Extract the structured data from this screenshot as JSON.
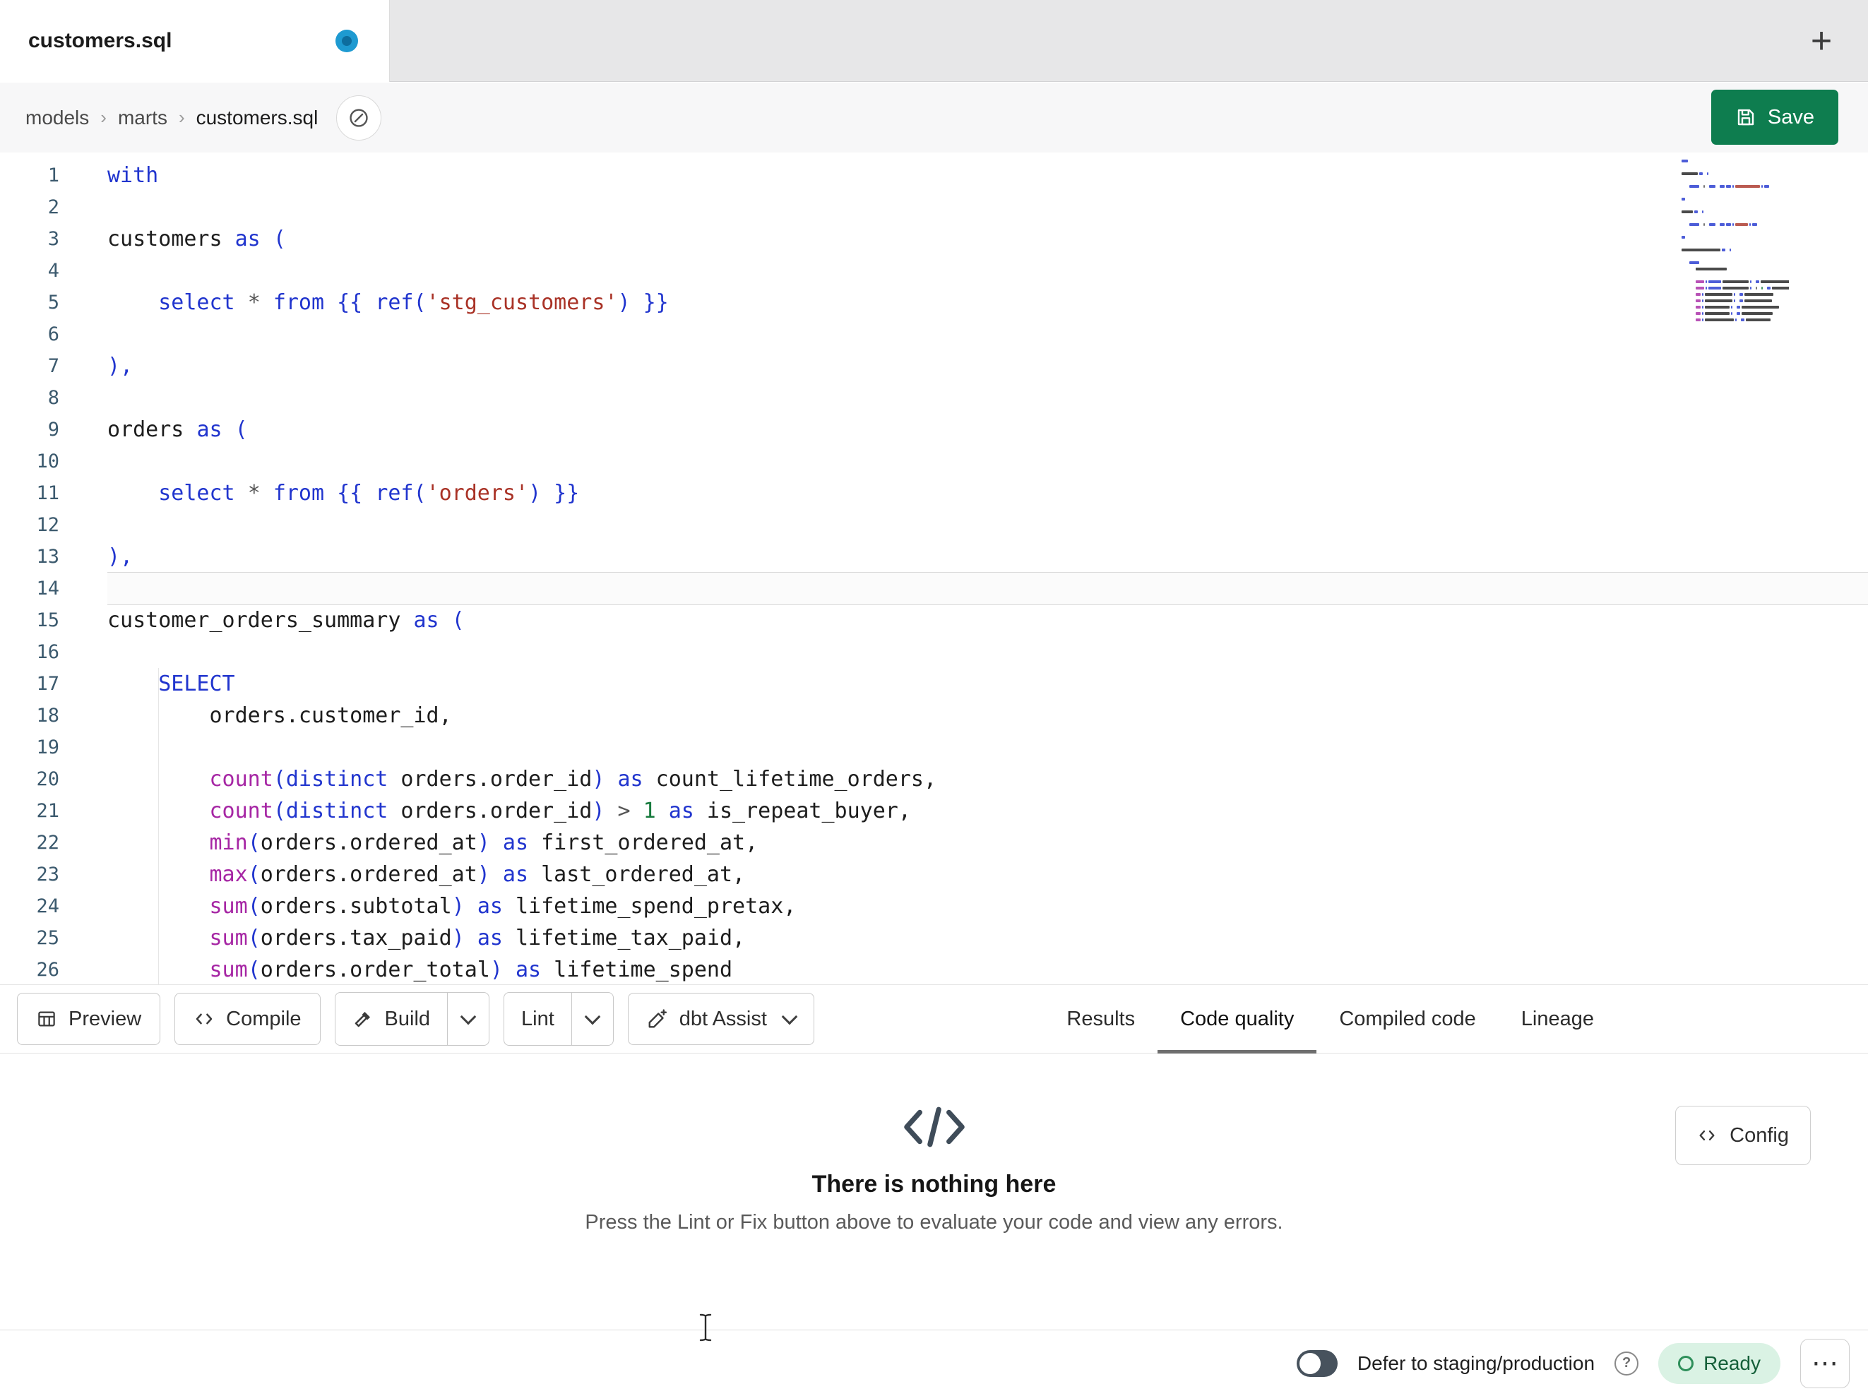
{
  "colors": {
    "save_button_green": "#0e7d4f",
    "unsaved_dot_blue": "#1e9ad1",
    "ready_badge_bg": "#daf2e4",
    "ready_badge_text": "#15603a",
    "active_tab_underline": "#6e6e6e"
  },
  "tab_bar": {
    "active_tab": {
      "title": "customers.sql",
      "modified": true
    },
    "new_tab_button": "+"
  },
  "breadcrumb": {
    "items": [
      "models",
      "marts",
      "customers.sql"
    ],
    "separator": "›"
  },
  "save_button": {
    "label": "Save"
  },
  "editor": {
    "active_line": 14,
    "lines": [
      {
        "n": 1,
        "t": [
          [
            "with",
            "kw"
          ]
        ]
      },
      {
        "n": 2,
        "t": []
      },
      {
        "n": 3,
        "t": [
          [
            "customers ",
            "id"
          ],
          [
            "as",
            "kw"
          ],
          [
            " ",
            "id"
          ],
          [
            "(",
            "pn"
          ]
        ]
      },
      {
        "n": 4,
        "t": []
      },
      {
        "n": 5,
        "t": [
          [
            "    ",
            "id"
          ],
          [
            "select",
            "kw"
          ],
          [
            " ",
            "id"
          ],
          [
            "*",
            "op"
          ],
          [
            " ",
            "id"
          ],
          [
            "from",
            "kw"
          ],
          [
            " ",
            "id"
          ],
          [
            "{{ ",
            "pn"
          ],
          [
            "ref",
            "kw"
          ],
          [
            "(",
            "pn"
          ],
          [
            "'stg_customers'",
            "str"
          ],
          [
            ")",
            "pn"
          ],
          [
            " }}",
            "pn"
          ]
        ]
      },
      {
        "n": 6,
        "t": []
      },
      {
        "n": 7,
        "t": [
          [
            "),",
            "pn"
          ]
        ]
      },
      {
        "n": 8,
        "t": []
      },
      {
        "n": 9,
        "t": [
          [
            "orders ",
            "id"
          ],
          [
            "as",
            "kw"
          ],
          [
            " ",
            "id"
          ],
          [
            "(",
            "pn"
          ]
        ]
      },
      {
        "n": 10,
        "t": []
      },
      {
        "n": 11,
        "t": [
          [
            "    ",
            "id"
          ],
          [
            "select",
            "kw"
          ],
          [
            " ",
            "id"
          ],
          [
            "*",
            "op"
          ],
          [
            " ",
            "id"
          ],
          [
            "from",
            "kw"
          ],
          [
            " ",
            "id"
          ],
          [
            "{{ ",
            "pn"
          ],
          [
            "ref",
            "kw"
          ],
          [
            "(",
            "pn"
          ],
          [
            "'orders'",
            "str"
          ],
          [
            ")",
            "pn"
          ],
          [
            " }}",
            "pn"
          ]
        ]
      },
      {
        "n": 12,
        "t": []
      },
      {
        "n": 13,
        "t": [
          [
            "),",
            "pn"
          ]
        ]
      },
      {
        "n": 14,
        "t": []
      },
      {
        "n": 15,
        "t": [
          [
            "customer_orders_summary ",
            "id"
          ],
          [
            "as",
            "kw"
          ],
          [
            " ",
            "id"
          ],
          [
            "(",
            "pn"
          ]
        ]
      },
      {
        "n": 16,
        "t": []
      },
      {
        "n": 17,
        "t": [
          [
            "    ",
            "id"
          ],
          [
            "SELECT",
            "kw"
          ]
        ]
      },
      {
        "n": 18,
        "t": [
          [
            "        ",
            "id"
          ],
          [
            "orders.customer_id,",
            "id"
          ]
        ]
      },
      {
        "n": 19,
        "t": []
      },
      {
        "n": 20,
        "t": [
          [
            "        ",
            "id"
          ],
          [
            "count",
            "fn"
          ],
          [
            "(",
            "pn"
          ],
          [
            "distinct",
            "kw"
          ],
          [
            " orders.order_id",
            "id"
          ],
          [
            ")",
            "pn"
          ],
          [
            " ",
            "id"
          ],
          [
            "as",
            "kw"
          ],
          [
            " count_lifetime_orders,",
            "id"
          ]
        ]
      },
      {
        "n": 21,
        "t": [
          [
            "        ",
            "id"
          ],
          [
            "count",
            "fn"
          ],
          [
            "(",
            "pn"
          ],
          [
            "distinct",
            "kw"
          ],
          [
            " orders.order_id",
            "id"
          ],
          [
            ")",
            "pn"
          ],
          [
            " ",
            "id"
          ],
          [
            ">",
            "op"
          ],
          [
            " ",
            "id"
          ],
          [
            "1",
            "num"
          ],
          [
            " ",
            "id"
          ],
          [
            "as",
            "kw"
          ],
          [
            " is_repeat_buyer,",
            "id"
          ]
        ]
      },
      {
        "n": 22,
        "t": [
          [
            "        ",
            "id"
          ],
          [
            "min",
            "fn"
          ],
          [
            "(",
            "pn"
          ],
          [
            "orders.ordered_at",
            "id"
          ],
          [
            ")",
            "pn"
          ],
          [
            " ",
            "id"
          ],
          [
            "as",
            "kw"
          ],
          [
            " first_ordered_at,",
            "id"
          ]
        ]
      },
      {
        "n": 23,
        "t": [
          [
            "        ",
            "id"
          ],
          [
            "max",
            "fn"
          ],
          [
            "(",
            "pn"
          ],
          [
            "orders.ordered_at",
            "id"
          ],
          [
            ")",
            "pn"
          ],
          [
            " ",
            "id"
          ],
          [
            "as",
            "kw"
          ],
          [
            " last_ordered_at,",
            "id"
          ]
        ]
      },
      {
        "n": 24,
        "t": [
          [
            "        ",
            "id"
          ],
          [
            "sum",
            "fn"
          ],
          [
            "(",
            "pn"
          ],
          [
            "orders.subtotal",
            "id"
          ],
          [
            ")",
            "pn"
          ],
          [
            " ",
            "id"
          ],
          [
            "as",
            "kw"
          ],
          [
            " lifetime_spend_pretax,",
            "id"
          ]
        ]
      },
      {
        "n": 25,
        "t": [
          [
            "        ",
            "id"
          ],
          [
            "sum",
            "fn"
          ],
          [
            "(",
            "pn"
          ],
          [
            "orders.tax_paid",
            "id"
          ],
          [
            ")",
            "pn"
          ],
          [
            " ",
            "id"
          ],
          [
            "as",
            "kw"
          ],
          [
            " lifetime_tax_paid,",
            "id"
          ]
        ]
      },
      {
        "n": 26,
        "t": [
          [
            "        ",
            "id"
          ],
          [
            "sum",
            "fn"
          ],
          [
            "(",
            "pn"
          ],
          [
            "orders.order_total",
            "id"
          ],
          [
            ")",
            "pn"
          ],
          [
            " ",
            "id"
          ],
          [
            "as",
            "kw"
          ],
          [
            " lifetime_spend",
            "id"
          ]
        ]
      }
    ]
  },
  "action_bar": {
    "buttons": {
      "preview": "Preview",
      "compile": "Compile",
      "build": "Build",
      "lint": "Lint",
      "assist": "dbt Assist"
    },
    "tabs": [
      {
        "label": "Results",
        "active": false
      },
      {
        "label": "Code quality",
        "active": true
      },
      {
        "label": "Compiled code",
        "active": false
      },
      {
        "label": "Lineage",
        "active": false
      }
    ]
  },
  "empty_state": {
    "title": "There is nothing here",
    "subtitle": "Press the Lint or Fix button above to evaluate your code and view any errors.",
    "config_label": "Config"
  },
  "status_bar": {
    "defer_label": "Defer to staging/production",
    "help_glyph": "?",
    "ready_label": "Ready",
    "more_glyph": "⋯"
  }
}
